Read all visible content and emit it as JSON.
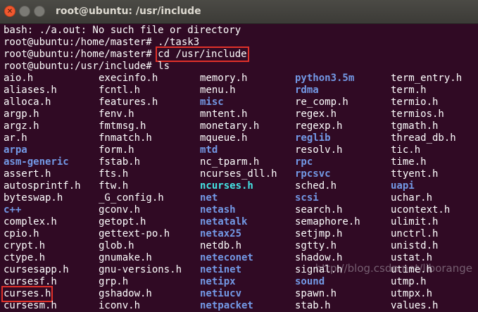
{
  "window": {
    "title": "root@ubuntu: /usr/include",
    "close_glyph": "✕"
  },
  "lines": [
    {
      "text": "bash: ./a.out: No such file or directory"
    },
    {
      "text": "root@ubuntu:/home/master# ./task3"
    },
    {
      "prompt": "root@ubuntu:/home/master# ",
      "command": "cd /usr/include",
      "highlighted": true
    },
    {
      "prompt": "root@ubuntu:/usr/include# ",
      "command": "ls"
    }
  ],
  "listing": [
    [
      "aio.h",
      "execinfo.h",
      "memory.h",
      "python3.5m",
      "term_entry.h"
    ],
    [
      "aliases.h",
      "fcntl.h",
      "menu.h",
      "rdma",
      "term.h"
    ],
    [
      "alloca.h",
      "features.h",
      "misc",
      "re_comp.h",
      "termio.h"
    ],
    [
      "argp.h",
      "fenv.h",
      "mntent.h",
      "regex.h",
      "termios.h"
    ],
    [
      "argz.h",
      "fmtmsg.h",
      "monetary.h",
      "regexp.h",
      "tgmath.h"
    ],
    [
      "ar.h",
      "fnmatch.h",
      "mqueue.h",
      "reglib",
      "thread_db.h"
    ],
    [
      "arpa",
      "form.h",
      "mtd",
      "resolv.h",
      "tic.h"
    ],
    [
      "asm-generic",
      "fstab.h",
      "nc_tparm.h",
      "rpc",
      "time.h"
    ],
    [
      "assert.h",
      "fts.h",
      "ncurses_dll.h",
      "rpcsvc",
      "ttyent.h"
    ],
    [
      "autosprintf.h",
      "ftw.h",
      "ncurses.h",
      "sched.h",
      "uapi"
    ],
    [
      "byteswap.h",
      "_G_config.h",
      "net",
      "scsi",
      "uchar.h"
    ],
    [
      "c++",
      "gconv.h",
      "netash",
      "search.h",
      "ucontext.h"
    ],
    [
      "complex.h",
      "getopt.h",
      "netatalk",
      "semaphore.h",
      "ulimit.h"
    ],
    [
      "cpio.h",
      "gettext-po.h",
      "netax25",
      "setjmp.h",
      "unctrl.h"
    ],
    [
      "crypt.h",
      "glob.h",
      "netdb.h",
      "sgtty.h",
      "unistd.h"
    ],
    [
      "ctype.h",
      "gnumake.h",
      "neteconet",
      "shadow.h",
      "ustat.h"
    ],
    [
      "cursesapp.h",
      "gnu-versions.h",
      "netinet",
      "signal.h",
      "utime.h"
    ],
    [
      "cursesf.h",
      "grp.h",
      "netipx",
      "sound",
      "utmp.h"
    ],
    [
      "curses.h",
      "gshadow.h",
      "netiucv",
      "spawn.h",
      "utmpx.h"
    ],
    [
      "cursesm.h",
      "iconv.h",
      "netpacket",
      "stab.h",
      "values.h"
    ]
  ],
  "listing_types": [
    [
      "file",
      "file",
      "file",
      "dir",
      "file"
    ],
    [
      "file",
      "file",
      "file",
      "dir",
      "file"
    ],
    [
      "file",
      "file",
      "dir",
      "file",
      "file"
    ],
    [
      "file",
      "file",
      "file",
      "file",
      "file"
    ],
    [
      "file",
      "file",
      "file",
      "file",
      "file"
    ],
    [
      "file",
      "file",
      "file",
      "dir",
      "file"
    ],
    [
      "dir",
      "file",
      "dir",
      "file",
      "file"
    ],
    [
      "dir",
      "file",
      "file",
      "dir",
      "file"
    ],
    [
      "file",
      "file",
      "file",
      "dir",
      "file"
    ],
    [
      "file",
      "file",
      "link",
      "file",
      "dir"
    ],
    [
      "file",
      "file",
      "dir",
      "dir",
      "file"
    ],
    [
      "dir",
      "file",
      "dir",
      "file",
      "file"
    ],
    [
      "file",
      "file",
      "dir",
      "file",
      "file"
    ],
    [
      "file",
      "file",
      "dir",
      "file",
      "file"
    ],
    [
      "file",
      "file",
      "file",
      "file",
      "file"
    ],
    [
      "file",
      "file",
      "dir",
      "file",
      "file"
    ],
    [
      "file",
      "file",
      "dir",
      "file",
      "file"
    ],
    [
      "file",
      "file",
      "dir",
      "dir",
      "file"
    ],
    [
      "file",
      "file",
      "dir",
      "file",
      "file"
    ],
    [
      "file",
      "file",
      "dir",
      "file",
      "file"
    ]
  ],
  "highlighted_entries": [
    "curses.h"
  ],
  "watermark": "http://blog.csdn.net/liborange",
  "colors": {
    "background": "#300a24",
    "text": "#ffffff",
    "directory": "#7399e6",
    "link": "#44e6e6",
    "highlight_box": "#e0312a",
    "close_button": "#f0582f"
  }
}
